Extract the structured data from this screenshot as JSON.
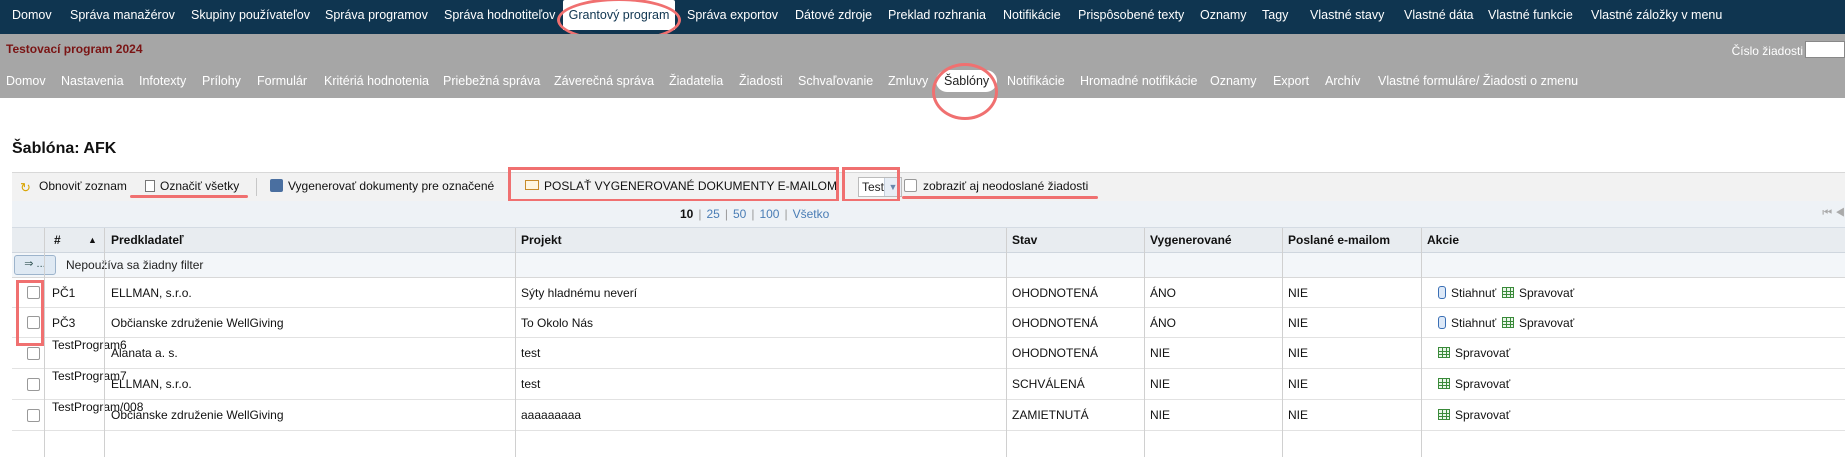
{
  "top_nav": [
    "Domov",
    "Správa manažérov",
    "Skupiny používateľov",
    "Správa programov",
    "Správa hodnotiteľov",
    "Grantový program",
    "Správa exportov",
    "Dátové zdroje",
    "Preklad rozhrania",
    "Notifikácie",
    "Prispôsobené texty",
    "Oznamy",
    "Tagy",
    "Vlastné stavy",
    "Vlastné dáta",
    "Vlastné funkcie",
    "Vlastné záložky v menu"
  ],
  "program": {
    "title": "Testovací program 2024",
    "cislo_label": "Číslo žiadosti",
    "cislo_value": ""
  },
  "sub_nav": [
    "Domov",
    "Nastavenia",
    "Infotexty",
    "Prílohy",
    "Formulár",
    "Kritériá hodnotenia",
    "Priebežná správa",
    "Záverečná správa",
    "Žiadatelia",
    "Žiadosti",
    "Schvaľovanie",
    "Zmluvy",
    "Šablóny",
    "Notifikácie",
    "Hromadné notifikácie",
    "Oznamy",
    "Export",
    "Archív",
    "Vlastné formuláre/ Žiadosti o zmenu"
  ],
  "section_title": "Šablóna: AFK",
  "toolbar": {
    "refresh": "Obnoviť zoznam",
    "select_all": "Označiť všetky",
    "generate": "Vygenerovať dokumenty pre označené",
    "send_email": "POSLAŤ VYGENEROVANÉ DOKUMENTY E-MAILOM",
    "select_value": "Test",
    "show_unsent": "zobraziť aj neodoslané žiadosti"
  },
  "pager": {
    "current": "10",
    "options": [
      "25",
      "50",
      "100",
      "Všetko"
    ]
  },
  "columns": [
    "#",
    "Predkladateľ",
    "Projekt",
    "Stav",
    "Vygenerované",
    "Poslané e-mailom",
    "Akcie"
  ],
  "filter": {
    "button": "...",
    "text": "Nepoužíva sa žiadny filter"
  },
  "actions": {
    "download": "Stiahnuť",
    "manage": "Spravovať"
  },
  "rows": [
    {
      "id": "PČ1",
      "applicant": "ELLMAN, s.r.o.",
      "project": "Sýty hladnému neverí",
      "status": "OHODNOTENÁ",
      "generated": "ÁNO",
      "emailed": "NIE"
    },
    {
      "id": "PČ3",
      "applicant": "Občianske združenie WellGiving",
      "project": "To Okolo Nás",
      "status": "OHODNOTENÁ",
      "generated": "ÁNO",
      "emailed": "NIE"
    },
    {
      "id": "TestProgram6",
      "applicant": "Alanata a. s.",
      "project": "test",
      "status": "OHODNOTENÁ",
      "generated": "NIE",
      "emailed": "NIE"
    },
    {
      "id": "TestProgram7",
      "applicant": "ELLMAN, s.r.o.",
      "project": "test",
      "status": "SCHVÁLENÁ",
      "generated": "NIE",
      "emailed": "NIE"
    },
    {
      "id": "TestProgram/008",
      "applicant": "Občianske združenie WellGiving",
      "project": "aaaaaaaaa",
      "status": "ZAMIETNUTÁ",
      "generated": "NIE",
      "emailed": "NIE"
    }
  ]
}
